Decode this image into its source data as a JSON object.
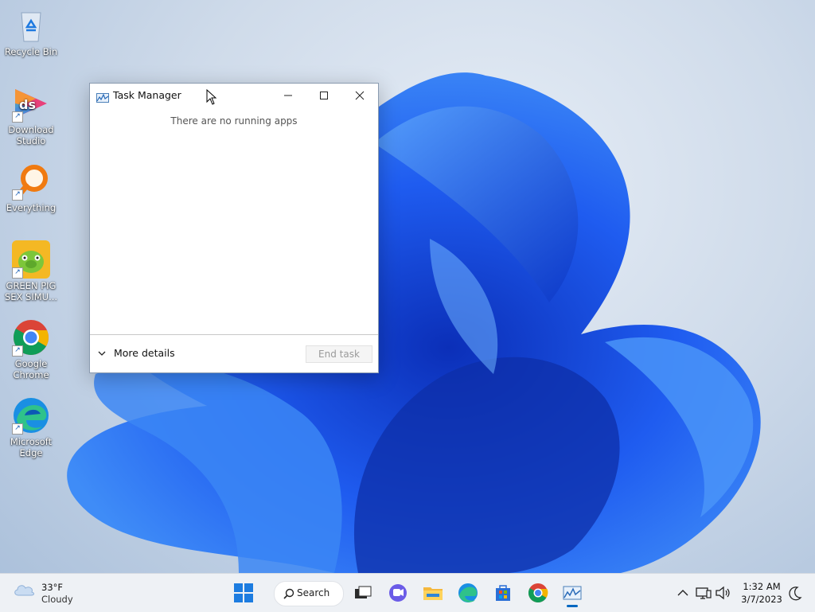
{
  "desktop": {
    "icons": [
      {
        "label": "Recycle Bin"
      },
      {
        "label": "Download Studio"
      },
      {
        "label": "Everything"
      },
      {
        "label": "GREEN PIG SEX SIMU..."
      },
      {
        "label": "Google Chrome"
      },
      {
        "label": "Microsoft Edge"
      }
    ]
  },
  "task_manager": {
    "title": "Task Manager",
    "empty_message": "There are no running apps",
    "more_details_label": "More details",
    "end_task_label": "End task"
  },
  "taskbar": {
    "weather": {
      "temp": "33°F",
      "condition": "Cloudy"
    },
    "search_label": "Search",
    "clock": {
      "time": "1:32 AM",
      "date": "3/7/2023"
    }
  },
  "colors": {
    "accent": "#0067c0",
    "wallpaper_blue": "#1a56e8"
  }
}
